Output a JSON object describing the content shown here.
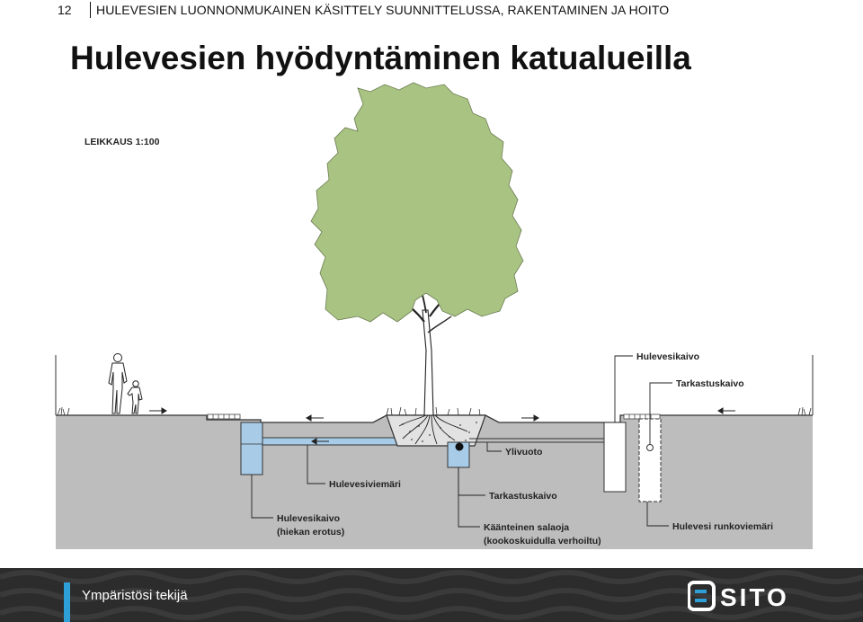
{
  "header": {
    "page_number": "12",
    "running_title": "HULEVESIEN LUONNONMUKAINEN KÄSITTELY SUUNNITTELUSSA, RAKENTAMINEN JA HOITO"
  },
  "title": "Hulevesien hyödyntäminen katualueilla",
  "diagram": {
    "scale_label": "LEIKKAUS 1:100",
    "labels": {
      "hulevesikaivo_top": "Hulevesikaivo",
      "tarkastuskaivo_top": "Tarkastuskaivo",
      "ylivuoto": "Ylivuoto",
      "hulevesiviemari": "Hulevesiviemäri",
      "tarkastuskaivo_bottom": "Tarkastuskaivo",
      "hulevesikaivo_line1": "Hulevesikaivo",
      "hulevesikaivo_line2": "(hiekan erotus)",
      "salaoja_line1": "Käänteinen salaoja",
      "salaoja_line2": "(kookoskuidulla verhoiltu)",
      "runkoviemari": "Hulevesi runkoviemäri"
    },
    "colors": {
      "ground": "#bdbdbd",
      "canopy": "#a9c383",
      "water": "#a8cce8"
    }
  },
  "footer": {
    "tagline": "Ympäristösi tekijä",
    "logo_text": "SITO",
    "accent_color": "#2f9fd8"
  }
}
